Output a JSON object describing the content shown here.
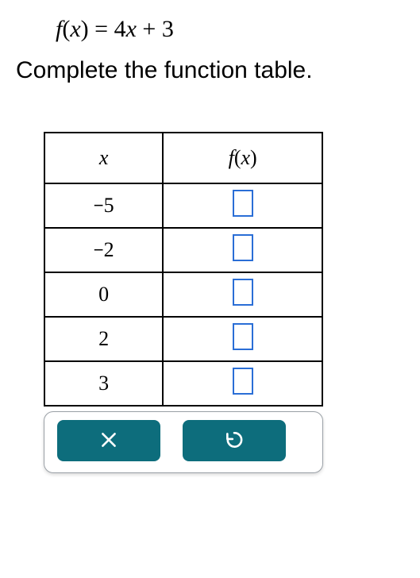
{
  "equation": {
    "fn": "f",
    "var": "x",
    "rhs_coeff": "4",
    "rhs_var": "x",
    "rhs_op": "+",
    "rhs_const": "3"
  },
  "instruction": "Complete the function table.",
  "table": {
    "header_x": "x",
    "header_fx_fn": "f",
    "header_fx_var": "x",
    "rows": [
      {
        "x_neg": "−",
        "x_num": "5",
        "fx": ""
      },
      {
        "x_neg": "−",
        "x_num": "2",
        "fx": ""
      },
      {
        "x_neg": "",
        "x_num": "0",
        "fx": ""
      },
      {
        "x_neg": "",
        "x_num": "2",
        "fx": ""
      },
      {
        "x_neg": "",
        "x_num": "3",
        "fx": ""
      }
    ]
  },
  "icons": {
    "clear": "close-icon",
    "reset": "undo-icon"
  }
}
